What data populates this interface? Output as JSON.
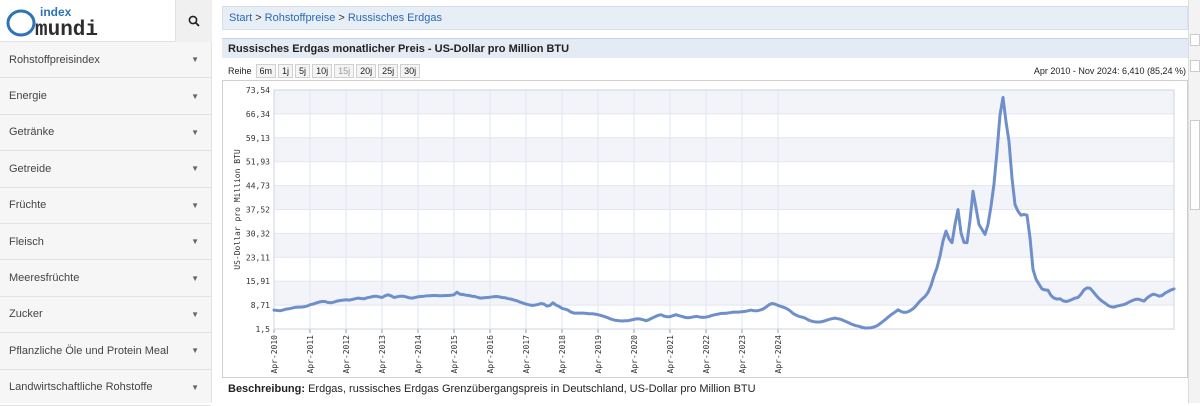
{
  "logo": {
    "top": "index",
    "bottom": "mundi"
  },
  "sidebar": {
    "items": [
      {
        "label": "Rohstoffpreisindex"
      },
      {
        "label": "Energie"
      },
      {
        "label": "Getränke"
      },
      {
        "label": "Getreide"
      },
      {
        "label": "Früchte"
      },
      {
        "label": "Fleisch"
      },
      {
        "label": "Meeresfrüchte"
      },
      {
        "label": "Zucker"
      },
      {
        "label": "Pflanzliche Öle und Protein Meal"
      },
      {
        "label": "Landwirtschaftliche Rohstoffe"
      }
    ]
  },
  "breadcrumb": {
    "start": "Start",
    "sep": ">",
    "level1": "Rohstoffpreise",
    "current": "Russisches Erdgas"
  },
  "header": {
    "title": "Russisches Erdgas monatlicher Preis - US-Dollar pro Million BTU"
  },
  "range": {
    "label": "Reihe",
    "buttons": [
      "6m",
      "1j",
      "5j",
      "10j",
      "15j",
      "20j",
      "25j",
      "30j"
    ],
    "period": "Apr 2010 - Nov 2024: 6,410 (85,24 %)"
  },
  "description": {
    "label": "Beschreibung:",
    "text": " Erdgas, russisches Erdgas Grenzübergangspreis in Deutschland, US-Dollar pro Million BTU"
  },
  "colors": {
    "line": "#6f8fcb",
    "band": "#f2f4fa",
    "link": "#2a6ab4"
  },
  "chart_data": {
    "type": "line",
    "ylabel": "US-Dollar pro Million BTU",
    "ylim": [
      1.5,
      73.54
    ],
    "yticks": [
      "1,5",
      "8,71",
      "15,91",
      "23,11",
      "30,32",
      "37,52",
      "44,73",
      "51,93",
      "59,13",
      "66,34",
      "73,54"
    ],
    "xticks": [
      "Apr-2010",
      "Apr-2011",
      "Apr-2012",
      "Apr-2013",
      "Apr-2014",
      "Apr-2015",
      "Apr-2016",
      "Apr-2017",
      "Apr-2018",
      "Apr-2019",
      "Apr-2020",
      "Apr-2021",
      "Apr-2022",
      "Apr-2023",
      "Apr-2024"
    ],
    "start": "Apr 2010",
    "series": [
      {
        "values": [
          7.2,
          7.1,
          7.0,
          7.2,
          7.5,
          7.6,
          7.8,
          8.0,
          8.1,
          8.1,
          8.2,
          8.4,
          8.8,
          9.0,
          9.3,
          9.6,
          9.8,
          9.8,
          9.5,
          9.4,
          9.6,
          9.9,
          10.1,
          10.2,
          10.3,
          10.2,
          10.4,
          10.6,
          10.8,
          10.7,
          10.6,
          10.9,
          11.1,
          11.3,
          11.4,
          11.2,
          11.0,
          11.5,
          11.8,
          11.5,
          11.0,
          11.2,
          11.4,
          11.4,
          11.2,
          10.9,
          10.8,
          11.0,
          11.2,
          11.3,
          11.4,
          11.5,
          11.5,
          11.6,
          11.6,
          11.5,
          11.5,
          11.6,
          11.6,
          11.7,
          11.8,
          12.6,
          12.0,
          11.9,
          11.7,
          11.6,
          11.4,
          11.3,
          11.0,
          10.8,
          10.9,
          11.0,
          11.1,
          11.2,
          11.3,
          11.2,
          11.0,
          10.9,
          10.7,
          10.5,
          10.2,
          10.0,
          9.6,
          9.3,
          9.0,
          8.8,
          8.6,
          8.7,
          8.9,
          9.2,
          9.0,
          8.4,
          8.6,
          9.4,
          8.7,
          8.3,
          7.7,
          7.5,
          7.2,
          6.6,
          6.3,
          6.3,
          6.3,
          6.3,
          6.2,
          6.1,
          6.1,
          6.0,
          5.8,
          5.6,
          5.3,
          5.0,
          4.6,
          4.3,
          4.1,
          4.0,
          3.9,
          4.0,
          4.0,
          4.2,
          4.4,
          4.6,
          4.5,
          4.3,
          4.0,
          4.3,
          4.8,
          5.2,
          5.6,
          5.8,
          5.4,
          5.2,
          5.2,
          5.5,
          5.8,
          5.5,
          5.3,
          5.0,
          4.9,
          5.0,
          5.2,
          5.3,
          5.1,
          5.0,
          5.1,
          5.3,
          5.6,
          5.8,
          6.0,
          6.2,
          6.2,
          6.3,
          6.4,
          6.6,
          6.6,
          6.6,
          6.7,
          6.8,
          7.0,
          7.2,
          7.0,
          7.0,
          7.2,
          7.5,
          8.1,
          8.8,
          9.2,
          9.0,
          8.6,
          8.3,
          8.0,
          7.6,
          7.0,
          6.2,
          5.7,
          5.3,
          5.1,
          4.8,
          4.3,
          3.9,
          3.7,
          3.6,
          3.6,
          3.8,
          4.1,
          4.4,
          4.6,
          4.8,
          4.6,
          4.4,
          4.0,
          3.6,
          3.2,
          2.8,
          2.5,
          2.3,
          2.0,
          1.8,
          1.8,
          1.9,
          2.1,
          2.5,
          3.1,
          3.8,
          4.5,
          5.3,
          6.0,
          6.6,
          7.3,
          6.8,
          6.5,
          6.6,
          7.0,
          7.6,
          8.5,
          9.6,
          10.5,
          11.3,
          12.5,
          14.6,
          17.5,
          20.0,
          23.5,
          28.0,
          31.0,
          28.7,
          27.5,
          33.0,
          37.5,
          30.5,
          27.6,
          27.5,
          34.3,
          43.0,
          38.0,
          33.0,
          31.5,
          30.0,
          33.0,
          38.5,
          45.2,
          55.0,
          66.0,
          71.3,
          64.0,
          58.0,
          47.0,
          39.0,
          37.0,
          35.8,
          36.0,
          35.8,
          29.0,
          19.5,
          16.5,
          15.0,
          13.6,
          13.3,
          13.2,
          11.6,
          10.8,
          10.5,
          10.6,
          10.0,
          9.8,
          10.0,
          10.4,
          10.8,
          11.0,
          12.0,
          13.3,
          13.9,
          13.8,
          12.8,
          11.7,
          10.7,
          9.9,
          9.3,
          8.6,
          8.2,
          8.1,
          8.4,
          8.6,
          8.8,
          9.1,
          9.6,
          10.0,
          10.4,
          10.5,
          10.2,
          9.9,
          10.8,
          11.5,
          12.0,
          11.8,
          11.4,
          11.6,
          12.3,
          12.8,
          13.3,
          13.6
        ]
      }
    ]
  }
}
